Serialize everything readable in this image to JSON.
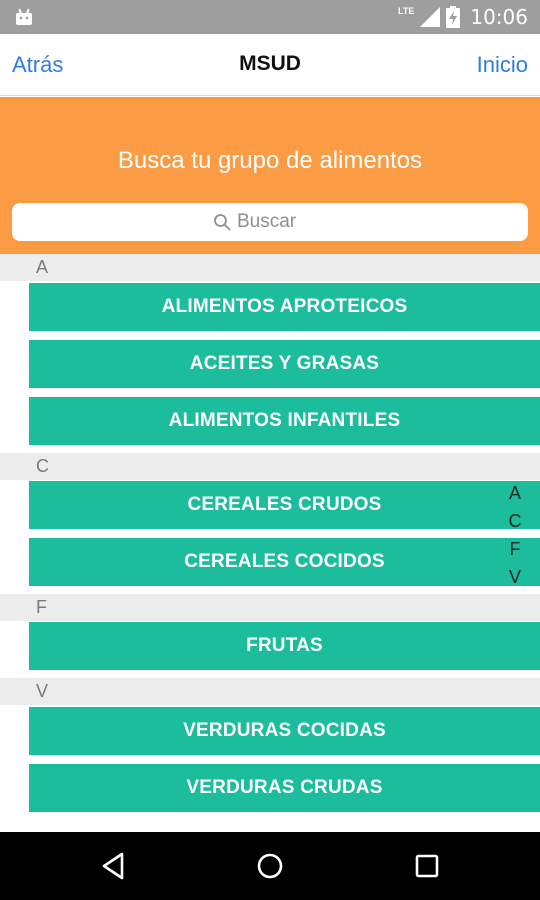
{
  "status_bar": {
    "network": "LTE",
    "time": "10:06",
    "icons": [
      "android-icon",
      "signal-icon",
      "battery-charging-icon"
    ]
  },
  "nav": {
    "back_label": "Atrás",
    "title": "MSUD",
    "home_label": "Inicio"
  },
  "header": {
    "heading": "Busca tu grupo de alimentos",
    "search_placeholder": "Buscar"
  },
  "sections": [
    {
      "letter": "A",
      "items": [
        "ALIMENTOS APROTEICOS",
        "ACEITES Y GRASAS",
        "ALIMENTOS INFANTILES"
      ]
    },
    {
      "letter": "C",
      "items": [
        "CEREALES CRUDOS",
        "CEREALES COCIDOS"
      ]
    },
    {
      "letter": "F",
      "items": [
        "FRUTAS"
      ]
    },
    {
      "letter": "V",
      "items": [
        "VERDURAS COCIDAS",
        "VERDURAS CRUDAS"
      ]
    }
  ],
  "index": [
    "A",
    "C",
    "F",
    "V"
  ],
  "colors": {
    "header": "#fb9c45",
    "item": "#1cbd9d",
    "link": "#2f7de1",
    "section": "#ececec"
  }
}
